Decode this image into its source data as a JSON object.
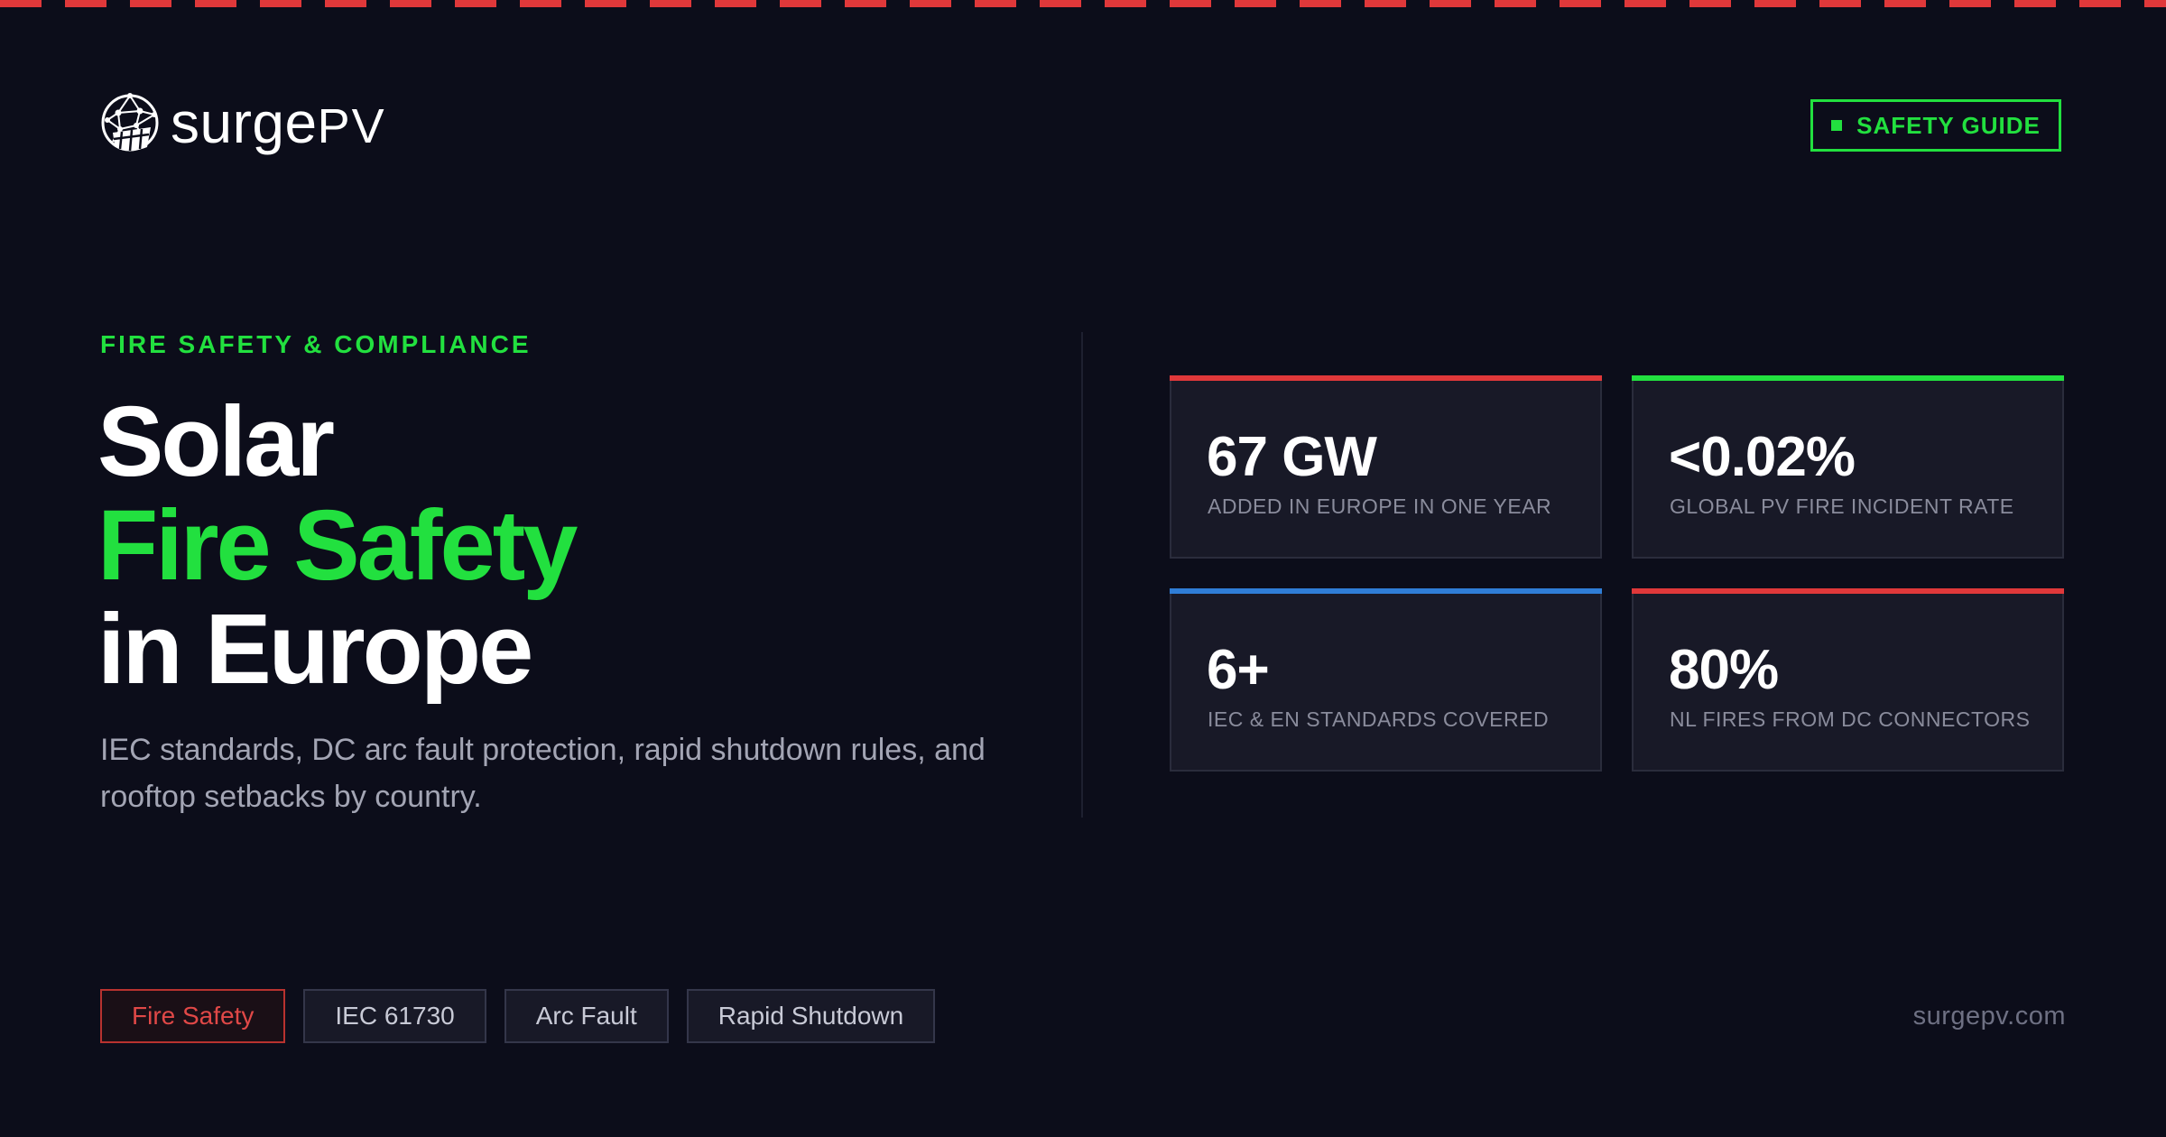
{
  "brand": {
    "logo_text_main": "surge",
    "logo_text_pv": "PV"
  },
  "badge": {
    "label": "SAFETY GUIDE"
  },
  "hero": {
    "eyebrow": "FIRE SAFETY & COMPLIANCE",
    "title_line1": "Solar",
    "title_line2": "Fire Safety",
    "title_line3": "in Europe",
    "subtitle": "IEC standards, DC arc fault protection, rapid shutdown rules, and rooftop setbacks by country."
  },
  "stats": [
    {
      "value": "67 GW",
      "label": "ADDED IN EUROPE IN ONE YEAR",
      "accent": "#e0383a"
    },
    {
      "value": "<0.02%",
      "label": "GLOBAL PV FIRE INCIDENT RATE",
      "accent": "#22e03f"
    },
    {
      "value": "6+",
      "label": "IEC & EN STANDARDS COVERED",
      "accent": "#2f7dd6"
    },
    {
      "value": "80%",
      "label": "NL FIRES FROM DC CONNECTORS",
      "accent": "#e0383a"
    }
  ],
  "tags": [
    {
      "label": "Fire Safety",
      "active": true
    },
    {
      "label": "IEC 61730",
      "active": false
    },
    {
      "label": "Arc Fault",
      "active": false
    },
    {
      "label": "Rapid Shutdown",
      "active": false
    }
  ],
  "footer": {
    "url": "surgepv.com"
  },
  "colors": {
    "background": "#0c0d1a",
    "accent_green": "#22e03f",
    "accent_red": "#e0383a",
    "accent_blue": "#2f7dd6"
  }
}
